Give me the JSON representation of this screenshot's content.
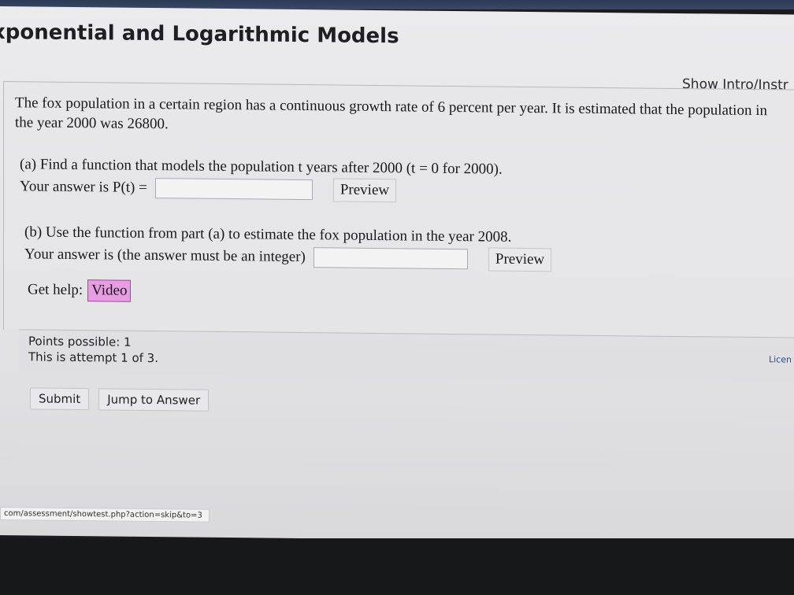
{
  "page": {
    "title": "xponential and Logarithmic Models",
    "show_intro": "Show Intro/Instr"
  },
  "question": {
    "text": "The fox population in a certain region has a continuous growth rate of 6 percent per year. It is estimated that the population in the year 2000 was 26800.",
    "part_a": {
      "prompt": "(a) Find a function that models the population t years after 2000 (t = 0 for 2000).",
      "answer_label": "Your answer is P(t) =",
      "answer_value": "",
      "preview_label": "Preview"
    },
    "part_b": {
      "prompt": "(b) Use the function from part (a) to estimate the fox population in the year 2008.",
      "answer_label": "Your answer is (the answer must be an integer)",
      "answer_value": "",
      "preview_label": "Preview"
    },
    "help": {
      "label": "Get help:",
      "video_label": "Video"
    }
  },
  "points": {
    "possible": "Points possible: 1",
    "attempt": "This is attempt 1 of 3.",
    "license": "Licen"
  },
  "actions": {
    "submit_label": "Submit",
    "jump_label": "Jump to Answer"
  },
  "status_bar": {
    "url": "com/assessment/showtest.php?action=skip&to=3"
  },
  "colors": {
    "video_button": "#e79de2",
    "screen_bg": "#e6e6e9"
  }
}
